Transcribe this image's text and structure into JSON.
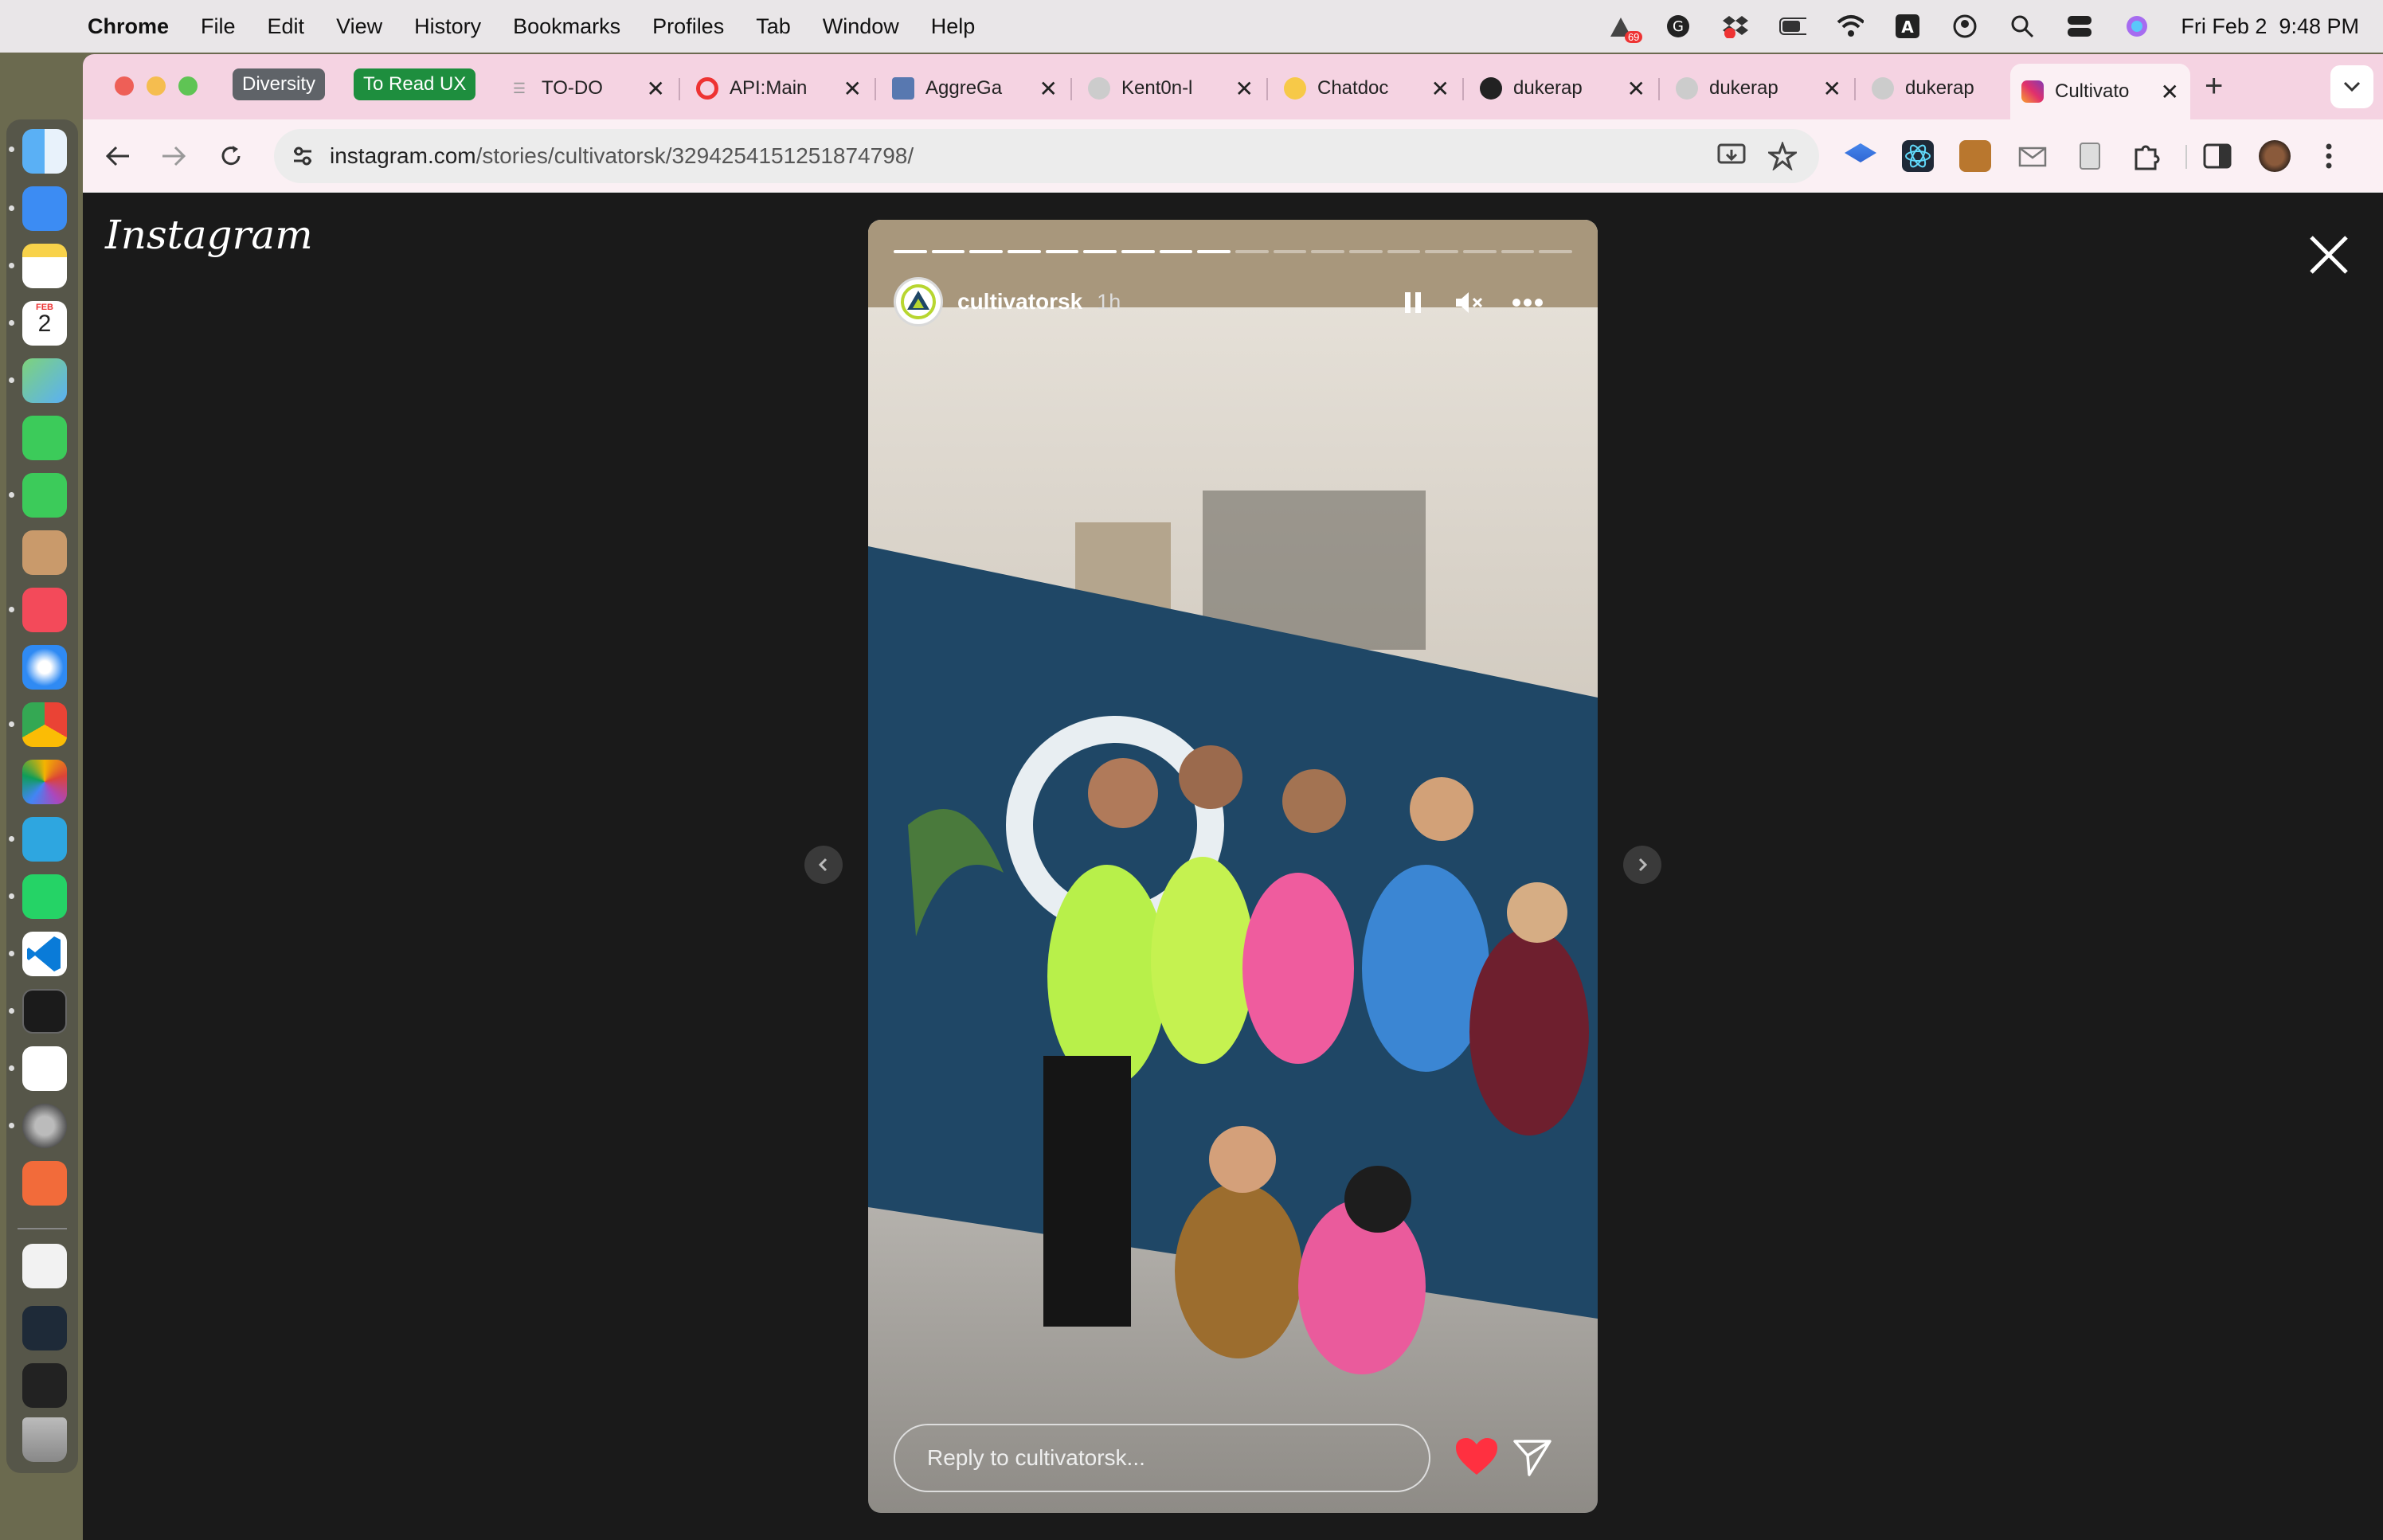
{
  "menubar": {
    "app": "Chrome",
    "items": [
      "File",
      "Edit",
      "View",
      "History",
      "Bookmarks",
      "Profiles",
      "Tab",
      "Window",
      "Help"
    ],
    "badge": "69",
    "datetime": "Fri Feb 2  9:48 PM"
  },
  "dock": {
    "calendar_month": "FEB",
    "calendar_day": "2"
  },
  "tabs": {
    "groups": [
      {
        "label": "Diversity",
        "color": "#5f6368"
      },
      {
        "label": "To Read UX",
        "color": "#1e8e3e"
      }
    ],
    "items": [
      {
        "title": "TO-DO"
      },
      {
        "title": "API:Main"
      },
      {
        "title": "AggreGa"
      },
      {
        "title": "Kent0n-l"
      },
      {
        "title": "Chatdoc"
      },
      {
        "title": "dukerap"
      },
      {
        "title": "dukerap"
      },
      {
        "title": "dukerap"
      },
      {
        "title": "Cultivato"
      }
    ],
    "close_glyph": "✕",
    "new_tab_glyph": "+"
  },
  "toolbar": {
    "url_host": "instagram.com",
    "url_path": "/stories/cultivatorsk/3294254151251874798/"
  },
  "instagram": {
    "logo": "Instagram",
    "story": {
      "username": "cultivatorsk",
      "time": "1h",
      "reply_placeholder": "Reply to cultivatorsk...",
      "progress_segments_total": 18,
      "progress_segments_done": 9,
      "paused": false,
      "muted": true
    },
    "colors": {
      "background": "#1a1a1a",
      "heart": "#ff3040"
    }
  }
}
